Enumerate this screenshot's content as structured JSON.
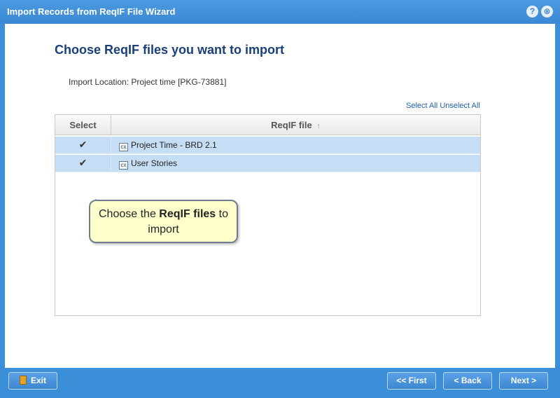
{
  "window": {
    "title": "Import Records from ReqIF File Wizard",
    "help_glyph": "?",
    "close_glyph": "⊗"
  },
  "main": {
    "heading": "Choose ReqIF files you want to import",
    "location": "Import Location: Project time [PKG-73881]",
    "select_all": "Select All",
    "unselect_all": "Unselect All"
  },
  "grid": {
    "columns": [
      "Select",
      "ReqIF file"
    ],
    "sort_icon": "↑",
    "rows": [
      {
        "checked": true,
        "check_glyph": "✔",
        "icon_text": "cx",
        "name": "Project Time - BRD 2.1"
      },
      {
        "checked": true,
        "check_glyph": "✔",
        "icon_text": "cx",
        "name": "User Stories"
      }
    ]
  },
  "callout": {
    "text_before": "Choose the ",
    "text_bold": "ReqIF files",
    "text_after": " to import"
  },
  "footer": {
    "exit_label": "Exit",
    "first_label": "<< First",
    "back_label": "< Back",
    "next_label": "Next >"
  },
  "colors": {
    "titlebar": "#3b8fd9",
    "heading": "#1b3f7a",
    "row_selected": "#c6def5",
    "callout_bg": "#ffffcc"
  }
}
